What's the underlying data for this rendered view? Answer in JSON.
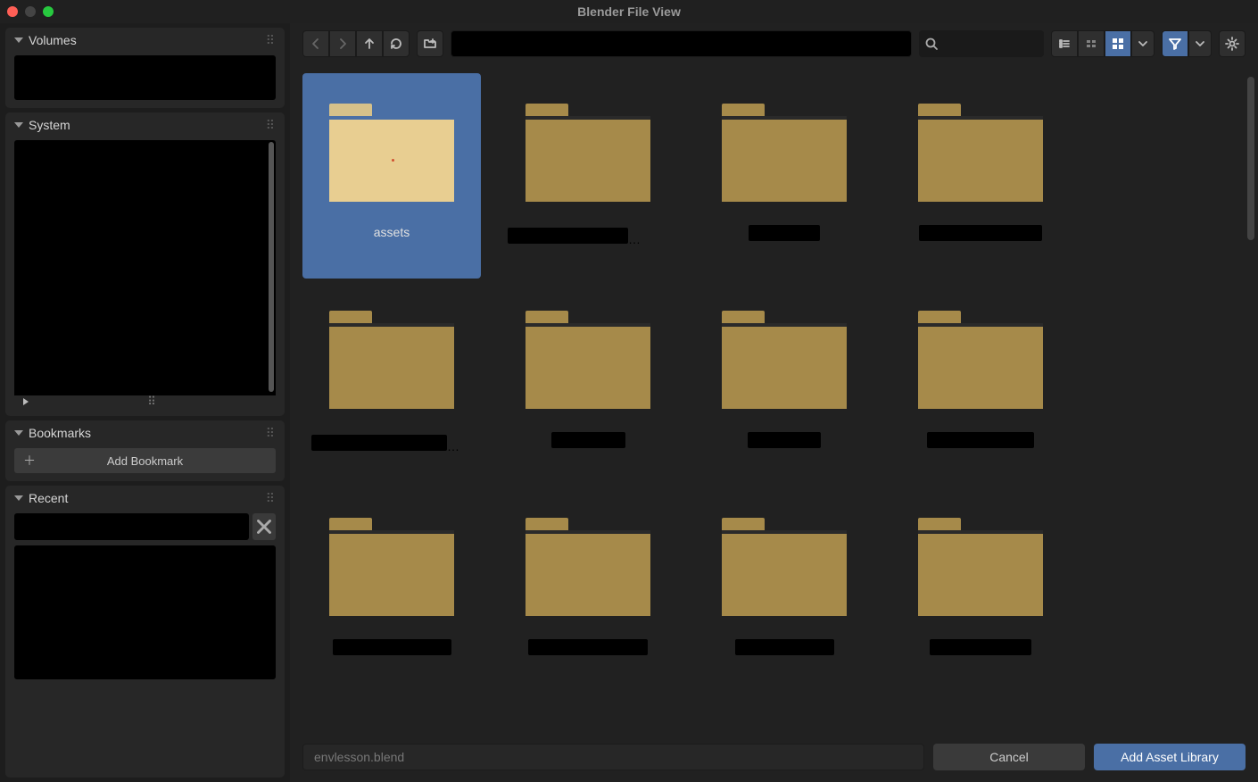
{
  "window": {
    "title": "Blender File View"
  },
  "sidebar": {
    "volumes_label": "Volumes",
    "system_label": "System",
    "bookmarks_label": "Bookmarks",
    "add_bookmark_label": "Add Bookmark",
    "recent_label": "Recent"
  },
  "toolbar": {
    "path": "",
    "search": ""
  },
  "grid": {
    "items": [
      {
        "name": "assets",
        "selected": true
      },
      {
        "name": "",
        "selected": false
      },
      {
        "name": "",
        "selected": false
      },
      {
        "name": "",
        "selected": false
      },
      {
        "name": "",
        "selected": false
      },
      {
        "name": "",
        "selected": false
      },
      {
        "name": "",
        "selected": false
      },
      {
        "name": "",
        "selected": false
      },
      {
        "name": "",
        "selected": false
      },
      {
        "name": "",
        "selected": false
      },
      {
        "name": "",
        "selected": false
      },
      {
        "name": "",
        "selected": false
      }
    ]
  },
  "footer": {
    "filename": "envlesson.blend",
    "cancel_label": "Cancel",
    "primary_label": "Add Asset Library"
  },
  "colors": {
    "accent": "#4a6fa5",
    "folder": "#a68a4a",
    "folder_selected": "#e8ce91"
  }
}
